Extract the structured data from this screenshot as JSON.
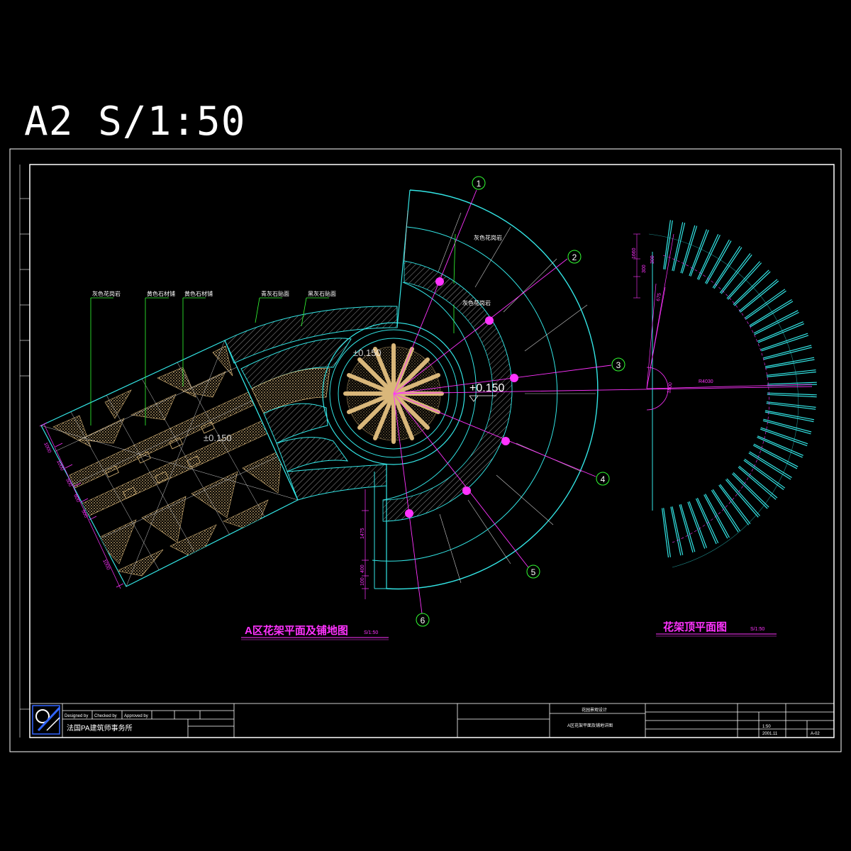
{
  "sheet": {
    "title": "A2 S/1:50"
  },
  "colors": {
    "background": "#000000",
    "frame": "#ffffff",
    "cyan": "#33e6e6",
    "magenta": "#ff33ff",
    "green": "#33ff33",
    "tan": "#d9b77a",
    "white": "#ffffff"
  },
  "plan_a": {
    "title": "A区花架平面及铺地图",
    "scale": "S/1:50",
    "level_main": "+0.150",
    "level_center": "±0.150",
    "level_path": "±0.150",
    "leaders": [
      "灰色花岗岩",
      "黄色石材铺",
      "黄色石材铺",
      "青灰石贴面",
      "黑灰石贴面",
      "灰色花岗岩",
      "灰色花岗岩"
    ],
    "grid_labels": [
      "1",
      "2",
      "3",
      "4",
      "5",
      "6"
    ]
  },
  "plan_b": {
    "title": "花架顶平面图",
    "scale": "S/1:50",
    "radius_label": "R4030",
    "dims": [
      "1660",
      "300",
      "300",
      "675",
      "1800"
    ]
  },
  "title_block": {
    "firm": "法国PA建筑师事务所",
    "designed_by": "Designed by",
    "checked_by": "Checked by",
    "approved_by": "Approved by",
    "project_name": "花园景观设计",
    "drawing_name": "A区花架平面及铺地详图",
    "scale": "1:50",
    "date": "2001.11",
    "drawing_no": "A-02"
  }
}
